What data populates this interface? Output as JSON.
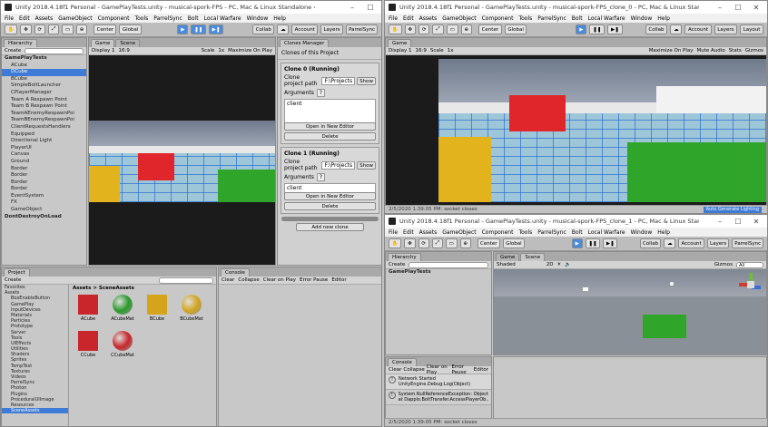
{
  "main": {
    "title": "Unity 2018.4.18f1 Personal - GamePlayTests.unity - musical-spork-FPS - PC, Mac & Linux Standalone <DX11>",
    "menu": [
      "File",
      "Edit",
      "Assets",
      "GameObject",
      "Component",
      "Tools",
      "ParrelSync",
      "Bolt",
      "Local Warfare",
      "Window",
      "Help"
    ],
    "toolbar": {
      "center": "Center",
      "global": "Global",
      "collab": "Collab",
      "account": "Account",
      "layers": "Layers",
      "layout": "ParrelSync"
    },
    "hierarchy": {
      "tab": "Hierarchy",
      "create": "Create",
      "search_placeholder": "All",
      "items": [
        {
          "label": "GamePlayTests",
          "type": "root"
        },
        {
          "label": "ACube"
        },
        {
          "label": "DCube",
          "type": "sel"
        },
        {
          "label": "BCube"
        },
        {
          "label": "SimpleBoltLauncher"
        },
        {
          "label": "CPlayerManager"
        },
        {
          "label": "Team A Respawn Point"
        },
        {
          "label": "Team B Respawn Point"
        },
        {
          "label": "TeamAEnemyRespawnPoi"
        },
        {
          "label": "TeamBEnemyRespawnPoi"
        },
        {
          "label": "ClientRequestsHandlers"
        },
        {
          "label": "Equipped"
        },
        {
          "label": "Directional Light"
        },
        {
          "label": "PlayerUI"
        },
        {
          "label": "Canvas"
        },
        {
          "label": "Ground"
        },
        {
          "label": "Border"
        },
        {
          "label": "Border"
        },
        {
          "label": "Border"
        },
        {
          "label": "Border"
        },
        {
          "label": "EventSystem"
        },
        {
          "label": "FX"
        },
        {
          "label": "GameObject"
        },
        {
          "label": "DontDestroyOnLoad",
          "type": "root"
        }
      ]
    },
    "game": {
      "tabs": [
        "Game",
        "Scene"
      ],
      "display": "Display 1",
      "aspect": "16:9",
      "scale": "Scale",
      "scale_val": "1x",
      "maximize": "Maximize On Play"
    },
    "clones": {
      "tab": "Clones Manager",
      "header": "Clones of this Project",
      "items": [
        {
          "title": "Clone 0 (Running)",
          "path_label": "Clone project path",
          "path_value": "F:\\Projects",
          "show": "Show",
          "args_label": "Arguments",
          "args_value": "client",
          "open": "Open in New Editor",
          "delete": "Delete"
        },
        {
          "title": "Clone 1 (Running)",
          "path_label": "Clone project path",
          "path_value": "F:\\Projects",
          "show": "Show",
          "args_label": "Arguments",
          "args_value": "client",
          "open": "Open in New Editor",
          "delete": "Delete"
        }
      ],
      "add": "Add new clone"
    },
    "project": {
      "tab": "Project",
      "create": "Create",
      "breadcrumb": "Assets > SceneAssets",
      "folders": [
        "Favorites",
        "Assets",
        "BoxEnableButton",
        "GamePlay",
        "InputDevices",
        "Materials",
        "Particles",
        "Prototype",
        "Server",
        "Tools",
        "UIEffects",
        "Utilities",
        "Shaders",
        "Sprites",
        "TempTest",
        "Textures",
        "Videos",
        "ParrelSync",
        "Photon",
        "Plugins",
        "ProceduralUIImage",
        "Resources",
        "SceneAssets"
      ],
      "assets": [
        {
          "name": "ACube",
          "color": "#c8262a",
          "shape": "cube"
        },
        {
          "name": "ACubeMat",
          "color": "#2a9a2a",
          "shape": "sphere"
        },
        {
          "name": "BCube",
          "color": "#d4a51c",
          "shape": "cube"
        },
        {
          "name": "BCubeMat",
          "color": "#d4a51c",
          "shape": "sphere"
        },
        {
          "name": "CCube",
          "color": "#c8262a",
          "shape": "cube"
        },
        {
          "name": "CCubeMat",
          "color": "#c8262a",
          "shape": "sphere"
        }
      ]
    },
    "console": {
      "tab": "Console",
      "clear": "Clear",
      "collapse": "Collapse",
      "clear_on_play": "Clear on Play",
      "error_pause": "Error Pause",
      "editor": "Editor"
    }
  },
  "clone0": {
    "title": "Unity 2018.4.18f1 Personal - GamePlayTests.unity - musical-spork-FPS_clone_0 - PC, Mac & Linux Standalone <DX11>",
    "menu": [
      "File",
      "Edit",
      "Assets",
      "GameObject",
      "Component",
      "Tools",
      "ParrelSync",
      "Bolt",
      "Local Warfare",
      "Window",
      "Help"
    ],
    "toolbar": {
      "center": "Center",
      "global": "Global",
      "collab": "Collab",
      "account": "Account",
      "layers": "Layers",
      "layout": "Layout"
    },
    "game": {
      "tab": "Game",
      "display": "Display 1",
      "aspect": "16:9",
      "scale": "Scale",
      "scale_val": "1x",
      "maximize": "Maximize On Play",
      "mute": "Mute Audio",
      "stats": "Stats",
      "gizmos": "Gizmos"
    },
    "status": "2/5/2020 1:39:05 PM: socket closes",
    "badge": "Auto Generate Lighting"
  },
  "clone1": {
    "title": "Unity 2018.4.18f1 Personal - GamePlayTests.unity - musical-spork-FPS_clone_1 - PC, Mac & Linux Standalone <DX11>",
    "menu": [
      "File",
      "Edit",
      "Assets",
      "GameObject",
      "Component",
      "Tools",
      "ParrelSync",
      "Bolt",
      "Local Warfare",
      "Window",
      "Help"
    ],
    "toolbar": {
      "center": "Center",
      "global": "Global",
      "collab": "Collab",
      "account": "Account",
      "layers": "Layers",
      "layout": "ParrelSync"
    },
    "hierarchy": {
      "tab": "Hierarchy",
      "create": "Create",
      "root": "GamePlayTests"
    },
    "scene": {
      "tabs": [
        "Game",
        "Scene"
      ],
      "shading": "Shaded",
      "mode": "2D",
      "gizmos": "Gizmos",
      "search": "All"
    },
    "console": {
      "tab": "Console",
      "buttons": [
        "Clear",
        "Collapse",
        "Clear on Play",
        "Error Pause",
        "Editor"
      ],
      "logs": [
        {
          "line1": "Network Started",
          "line2": "UnityEngine.Debug:Log(Object)"
        },
        {
          "line1": "System.NullReferenceException: Object ...",
          "line2": "at Dapplo.BoltTransfer.AccessPlayerOb..."
        }
      ]
    },
    "status": "2/5/2020 1:39:05 PM: socket closes"
  }
}
